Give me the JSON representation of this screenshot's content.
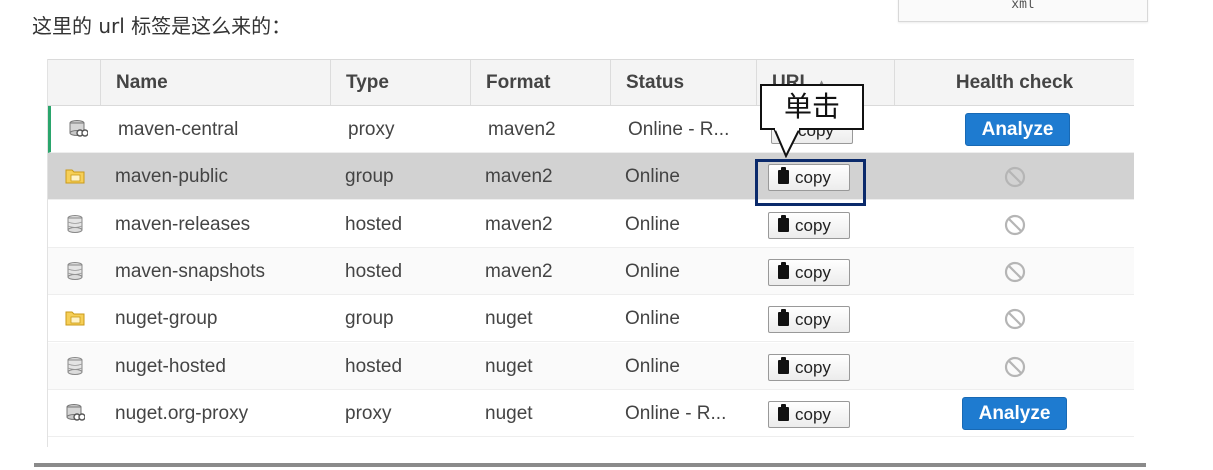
{
  "caption": "这里的 url 标签是这么来的：",
  "xml_box_label": "xml",
  "table": {
    "headers": {
      "name": "Name",
      "type": "Type",
      "format": "Format",
      "status": "Status",
      "url": "URL",
      "health": "Health check"
    },
    "rows": [
      {
        "icon": "proxy-repo-icon",
        "name": "maven-central",
        "type": "proxy",
        "format": "maven2",
        "status": "Online - R...",
        "copy": "copy",
        "health": "Analyze"
      },
      {
        "icon": "group-repo-icon",
        "name": "maven-public",
        "type": "group",
        "format": "maven2",
        "status": "Online",
        "copy": "copy",
        "health": "disabled"
      },
      {
        "icon": "hosted-repo-icon",
        "name": "maven-releases",
        "type": "hosted",
        "format": "maven2",
        "status": "Online",
        "copy": "copy",
        "health": "disabled"
      },
      {
        "icon": "hosted-repo-icon",
        "name": "maven-snapshots",
        "type": "hosted",
        "format": "maven2",
        "status": "Online",
        "copy": "copy",
        "health": "disabled"
      },
      {
        "icon": "group-repo-icon",
        "name": "nuget-group",
        "type": "group",
        "format": "nuget",
        "status": "Online",
        "copy": "copy",
        "health": "disabled"
      },
      {
        "icon": "hosted-repo-icon",
        "name": "nuget-hosted",
        "type": "hosted",
        "format": "nuget",
        "status": "Online",
        "copy": "copy",
        "health": "disabled"
      },
      {
        "icon": "proxy-repo-icon",
        "name": "nuget.org-proxy",
        "type": "proxy",
        "format": "nuget",
        "status": "Online - R...",
        "copy": "copy",
        "health": "Analyze"
      }
    ]
  },
  "callout_text": "单击",
  "colors": {
    "analyze_button": "#1e7bd0",
    "selected_row": "#d2d2d2",
    "highlight_border": "#0b2a6b",
    "focus_bar": "#2aa56c"
  }
}
